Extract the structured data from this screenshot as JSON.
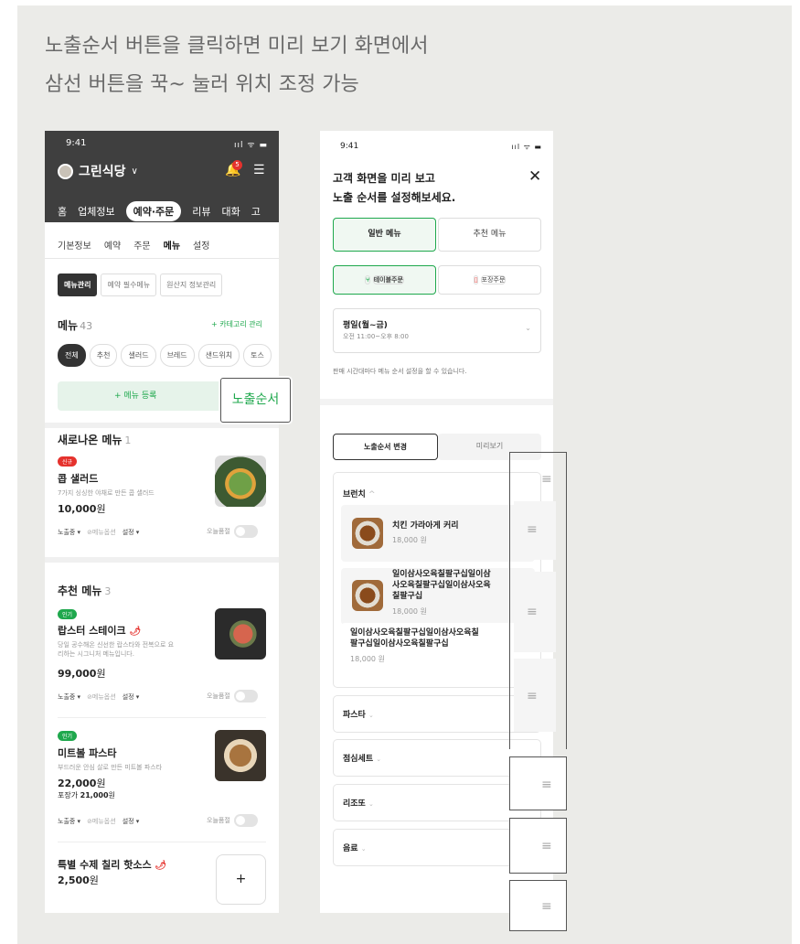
{
  "headline": {
    "line1": "노출순서 버튼을 클릭하면 미리 보기 화면에서",
    "line2": "삼선 버튼을 꾹~ 눌러 위치 조정 가능"
  },
  "left": {
    "time": "9:41",
    "system_icons": "ııl ᯤ ▬",
    "store": "그린식당",
    "bell_badge": "5",
    "nav": [
      "홈",
      "업체정보",
      "예약·주문",
      "리뷰",
      "대화",
      "고"
    ],
    "subnav": [
      "기본정보",
      "예약",
      "주문",
      "메뉴",
      "설정"
    ],
    "filters": [
      "메뉴관리",
      "예약 필수메뉴",
      "원산지 정보관리"
    ],
    "menu_title": "메뉴",
    "menu_count": "43",
    "category_link": "+ 카테고리 관리",
    "chips": [
      "전체",
      "추천",
      "샐러드",
      "브레드",
      "샌드위치",
      "토스"
    ],
    "register": "+ 메뉴 등록",
    "sections": {
      "new": {
        "title": "새로나온 메뉴",
        "count": "1"
      },
      "reco": {
        "title": "추천 메뉴",
        "count": "3"
      }
    },
    "items": [
      {
        "badge": "신규",
        "name": "콥 샐러드",
        "desc": "7가지 싱싱한 야채로 만든 콥 샐러드",
        "price": "10,000",
        "won": "원"
      },
      {
        "badge": "인기",
        "name": "랍스터 스테이크",
        "desc1": "당일 공수해온 신선한 랍스타와 전복으로 요",
        "desc2": "리하는 시그니처 메뉴입니다.",
        "price": "99,000",
        "won": "원"
      },
      {
        "badge": "인기",
        "name": "미트볼 파스타",
        "desc": "부드러운 안심 살로 만든 미트볼 파스타",
        "price": "22,000",
        "won": "원",
        "pack_label": "포장가",
        "pack_price": "21,000",
        "pack_won": "원"
      },
      {
        "name": "특별 수제 칠리 핫소스",
        "price": "2,500",
        "won": "원"
      }
    ],
    "ctrl": {
      "status": "노출중 ▾",
      "options": "⊘메뉴옵션",
      "settings": "설정 ▾",
      "soldout": "오늘품절"
    },
    "add": "+"
  },
  "callout": "노출순서",
  "right": {
    "time": "9:41",
    "system_icons": "ııl ᯤ ▬",
    "title1": "고객 화면을 미리 보고",
    "title2": "노출 순서를 설정해보세요.",
    "close": "✕",
    "seg1": [
      "일반 메뉴",
      "추천 메뉴"
    ],
    "seg2": [
      "테이블주문",
      "포장주문"
    ],
    "seg2_icons": [
      "fork-knife-icon",
      "bag-icon"
    ],
    "day_title": "평일(월~금)",
    "day_time": "오전 11:00~오후 8:00",
    "note": "판매 시간대마다 메뉴 순서 설정을 할 수 있습니다.",
    "tabs": [
      "노출순서 변경",
      "미리보기"
    ],
    "brunch": "브런치",
    "rows": [
      {
        "name": "치킨 가라아게 커리",
        "price": "18,000 원"
      },
      {
        "name1": "일이삼사오육칠팔구십일이삼",
        "name2": "사오육칠팔구십일이삼사오육",
        "name3": "칠팔구십",
        "price": "18,000 원"
      },
      {
        "name1": "일이삼사오육칠팔구십일이삼사오육칠",
        "name2": "팔구십일이삼사오육칠팔구십",
        "price": "18,000 원"
      }
    ],
    "categories": [
      "파스타",
      "점심세트",
      "리조또",
      "음료"
    ],
    "grip": "≡",
    "chev_up": "^",
    "chev_down": "⌄"
  }
}
